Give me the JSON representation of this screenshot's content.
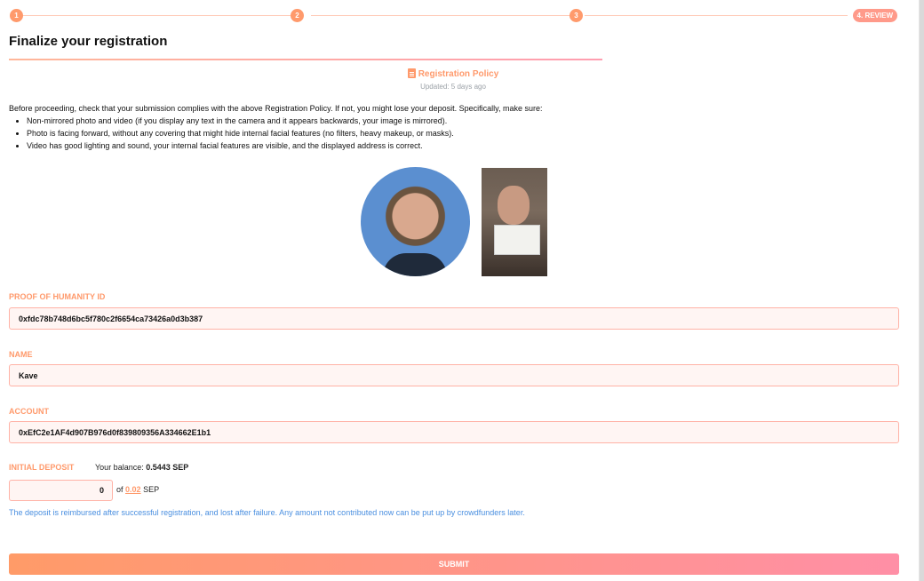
{
  "stepper": {
    "steps": [
      "1",
      "2",
      "3"
    ],
    "current": "4. REVIEW"
  },
  "page_title": "Finalize your registration",
  "policy": {
    "link_label": "Registration Policy",
    "updated": "Updated: 5 days ago"
  },
  "instructions": {
    "intro": "Before proceeding, check that your submission complies with the above Registration Policy. If not, you might lose your deposit. Specifically, make sure:",
    "items": [
      "Non-mirrored photo and video (if you display any text in the camera and it appears backwards, your image is mirrored).",
      "Photo is facing forward, without any covering that might hide internal facial features (no filters, heavy makeup, or masks).",
      "Video has good lighting and sound, your internal facial features are visible, and the displayed address is correct."
    ]
  },
  "fields": {
    "poh_id": {
      "label": "Proof of Humanity ID",
      "value": "0xfdc78b748d6bc5f780c2f6654ca73426a0d3b387"
    },
    "name": {
      "label": "Name",
      "value": "Kave"
    },
    "account": {
      "label": "Account",
      "value": "0xEfC2e1AF4d907B976d0f839809356A334662E1b1"
    }
  },
  "deposit": {
    "label": "Initial Deposit",
    "balance_prefix": "Your balance:",
    "balance_value": "0.5443 SEP",
    "input_value": "0",
    "of_prefix": "of",
    "required_amount": "0.02",
    "unit": "SEP",
    "note": "The deposit is reimbursed after successful registration, and lost after failure. Any amount not contributed now can be put up by crowdfunders later."
  },
  "submit_label": "Submit",
  "colors": {
    "accent": "#ff9a6c",
    "accent_pink": "#ff8fa6",
    "field_bg": "#fff5f3",
    "field_border": "#ffb2a6",
    "note_blue": "#4a8fe0"
  }
}
